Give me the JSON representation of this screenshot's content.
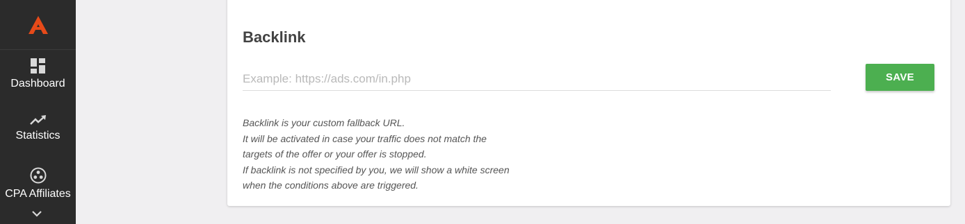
{
  "sidebar": {
    "logo_icon": "logo-a-icon",
    "accent_color": "#e64a19",
    "items": [
      {
        "label": "Dashboard",
        "icon": "dashboard-icon"
      },
      {
        "label": "Statistics",
        "icon": "trending-up-icon"
      },
      {
        "label": "CPA Affiliates",
        "icon": "affiliates-icon"
      }
    ],
    "more_icon": "chevron-down-icon"
  },
  "backlink": {
    "title": "Backlink",
    "input_value": "",
    "input_placeholder": "Example: https://ads.com/in.php",
    "save_label": "SAVE",
    "save_color": "#4caf50",
    "help_lines": [
      "Backlink is your custom fallback URL.",
      "It will be activated in case your traffic does not match the",
      "targets of the offer or your offer is stopped.",
      "If backlink is not specified by you, we will show a white screen",
      "when the conditions above are triggered."
    ]
  }
}
